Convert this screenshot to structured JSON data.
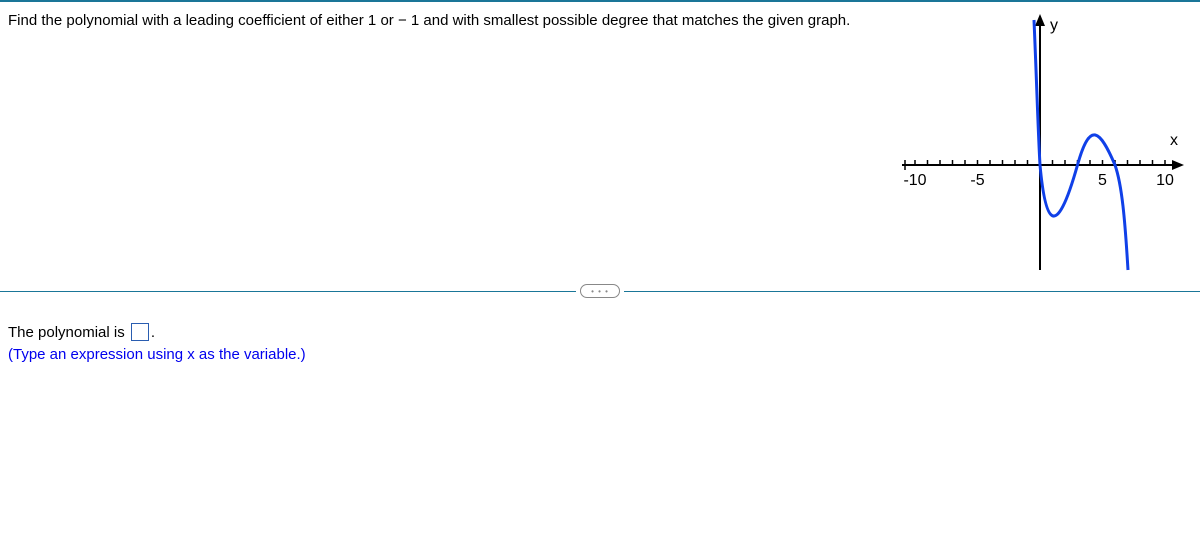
{
  "question": {
    "text_before_minus": "Find the polynomial with a leading coefficient of either 1 or ",
    "minus": "−",
    "text_after_minus": "1 and with smallest possible degree that matches the given graph."
  },
  "answer": {
    "prefix": "The polynomial is ",
    "period": ".",
    "hint": "(Type an expression using x as the variable.)"
  },
  "chart_data": {
    "type": "line",
    "xlabel": "x",
    "ylabel": "y",
    "xticks": [
      "-10",
      "-5",
      "5",
      "10"
    ],
    "x_range": [
      -11,
      11
    ],
    "description": "Cubic-like polynomial curve",
    "roots": [
      0,
      3,
      6
    ],
    "curve_points": [
      {
        "x": -0.5,
        "y_pixel_top": true
      },
      {
        "x": 0,
        "y": 0
      },
      {
        "x": 1.5,
        "y": -8
      },
      {
        "x": 3,
        "y": 0
      },
      {
        "x": 4.5,
        "y": 4
      },
      {
        "x": 6,
        "y": 0
      },
      {
        "x": 7,
        "y_pixel_bottom": true
      }
    ]
  },
  "separator": {
    "pill_text": "• • •"
  }
}
